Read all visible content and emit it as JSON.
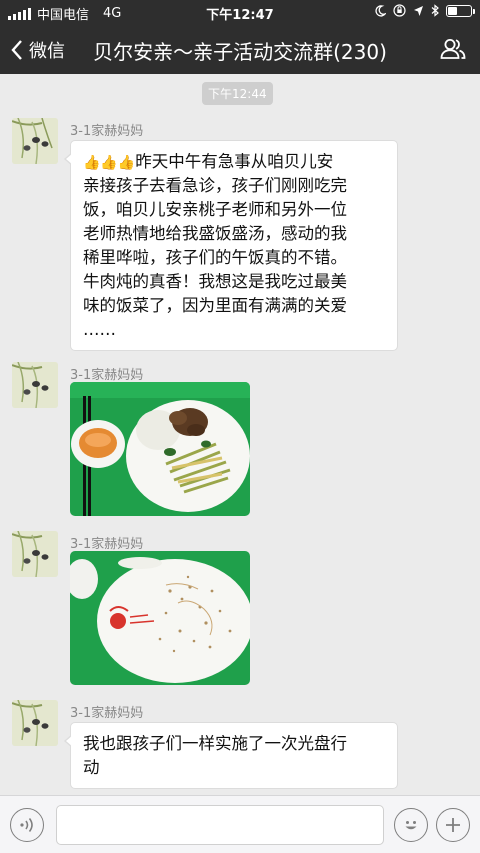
{
  "status_bar": {
    "carrier": "中国电信",
    "network": "4G",
    "time": "下午12:47"
  },
  "header": {
    "back_label": "微信",
    "title": "贝尔安亲～亲子活动交流群(230)"
  },
  "chat": {
    "timestamp": "下午12:44",
    "messages": [
      {
        "sender": "3-1家赫妈妈",
        "emoji": "👍👍👍",
        "lines": [
          "昨天中午有急事从咱贝儿安",
          "亲接孩子去看急诊，孩子们刚刚吃完",
          "饭，咱贝儿安亲桃子老师和另外一位",
          "老师热情地给我盛饭盛汤，感动的我",
          "稀里哗啦，孩子们的午饭真的不错。",
          "牛肉炖的真香！我想这是我吃过最美",
          "味的饭菜了，因为里面有满满的关爱",
          "……"
        ]
      },
      {
        "sender": "3-1家赫妈妈"
      },
      {
        "sender": "3-1家赫妈妈"
      },
      {
        "sender": "3-1家赫妈妈",
        "lines": [
          "我也跟孩子们一样实施了一次光盘行",
          "动"
        ]
      }
    ]
  },
  "icons": {
    "back": "chevron-left-icon",
    "group": "group-members-icon",
    "voice": "voice-icon",
    "emoji": "emoji-icon",
    "more": "plus-icon"
  },
  "colors": {
    "bar": "#2e2e2e",
    "chat_background": "#ebebeb",
    "tray_green": "#1fa04b"
  }
}
